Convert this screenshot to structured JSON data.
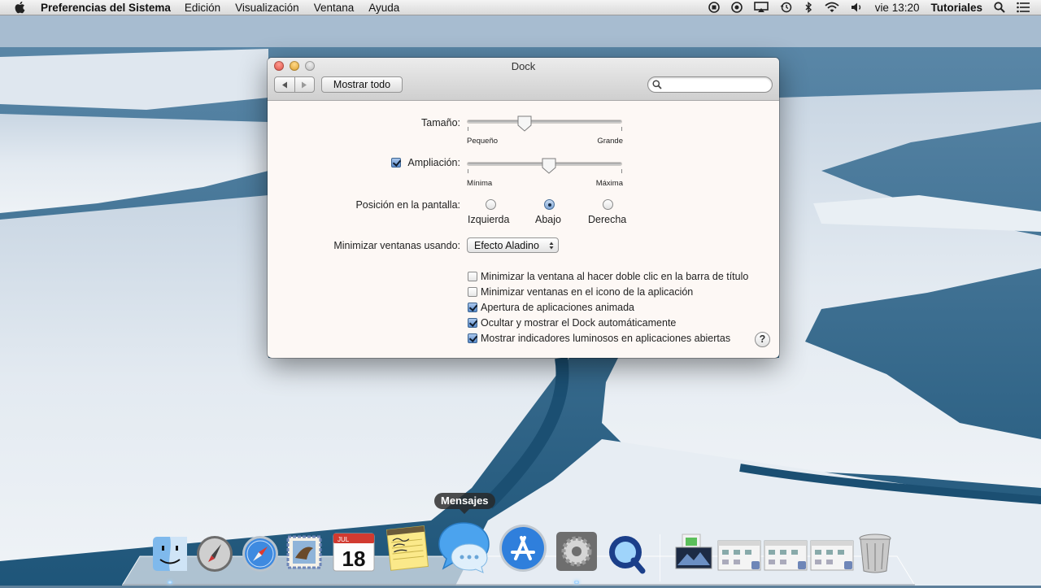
{
  "menubar": {
    "app_name": "Preferencias del Sistema",
    "menus": [
      "Edición",
      "Visualización",
      "Ventana",
      "Ayuda"
    ],
    "clock": "vie 13:20",
    "user": "Tutoriales"
  },
  "window": {
    "title": "Dock",
    "show_all_label": "Mostrar todo",
    "search": {
      "value": "",
      "placeholder": ""
    }
  },
  "settings": {
    "size": {
      "label": "Tamaño:",
      "min_label": "Pequeño",
      "max_label": "Grande",
      "value_fraction": 0.37
    },
    "magnification": {
      "label": "Ampliación:",
      "checked": true,
      "min_label": "Mínima",
      "max_label": "Máxima",
      "value_fraction": 0.53
    },
    "position": {
      "label": "Posición en la pantalla:",
      "options": [
        {
          "label": "Izquierda",
          "selected": false
        },
        {
          "label": "Abajo",
          "selected": true
        },
        {
          "label": "Derecha",
          "selected": false
        }
      ]
    },
    "minimize_effect": {
      "label": "Minimizar ventanas usando:",
      "selected": "Efecto Aladino"
    },
    "checkboxes": [
      {
        "label": "Minimizar la ventana al hacer doble clic en la barra de título",
        "checked": false
      },
      {
        "label": "Minimizar ventanas en el icono de la aplicación",
        "checked": false
      },
      {
        "label": "Apertura de aplicaciones animada",
        "checked": true
      },
      {
        "label": "Ocultar y mostrar el Dock automáticamente",
        "checked": true
      },
      {
        "label": "Mostrar indicadores luminosos en aplicaciones abiertas",
        "checked": true
      }
    ],
    "help_label": "?"
  },
  "dock": {
    "tooltip": "Mensajes",
    "calendar": {
      "month": "JUL",
      "day": "18"
    },
    "colors": {
      "accent": "#4a8ad4",
      "selected_checkbox": "#5b8ccc"
    }
  }
}
